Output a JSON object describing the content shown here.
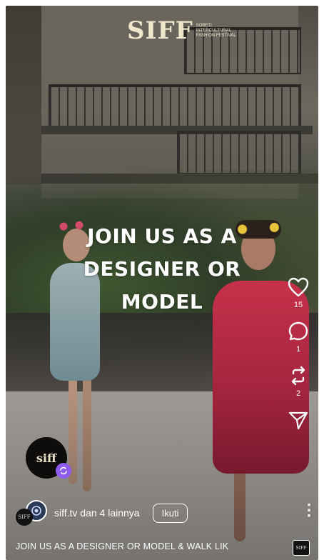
{
  "logo": {
    "mark": "SIFF",
    "subtitle": "SOBETI INTERCULTURAL FASHION FESTIVAL"
  },
  "headline": {
    "line1": "JOIN US AS A",
    "line2": "DESIGNER OR",
    "line3": "MODEL"
  },
  "actions": {
    "like": {
      "icon": "heart-icon",
      "count": "15"
    },
    "comment": {
      "icon": "comment-icon",
      "count": "1"
    },
    "repost": {
      "icon": "repost-icon",
      "count": "2"
    },
    "share": {
      "icon": "send-icon"
    }
  },
  "profile": {
    "avatar_text": "siff",
    "badge_icon": "collab-icon"
  },
  "user_row": {
    "name": "siff.tv dan 4 lainnya",
    "follow_label": "Ikuti",
    "more_icon": "more-vertical-icon",
    "more_glyph": "⋮"
  },
  "caption": "JOIN US AS A DESIGNER OR MODEL & WALK LIK",
  "music": {
    "label": "SIFF"
  },
  "colors": {
    "badge": "#8f5cf0",
    "dress_red": "#c7314a"
  }
}
